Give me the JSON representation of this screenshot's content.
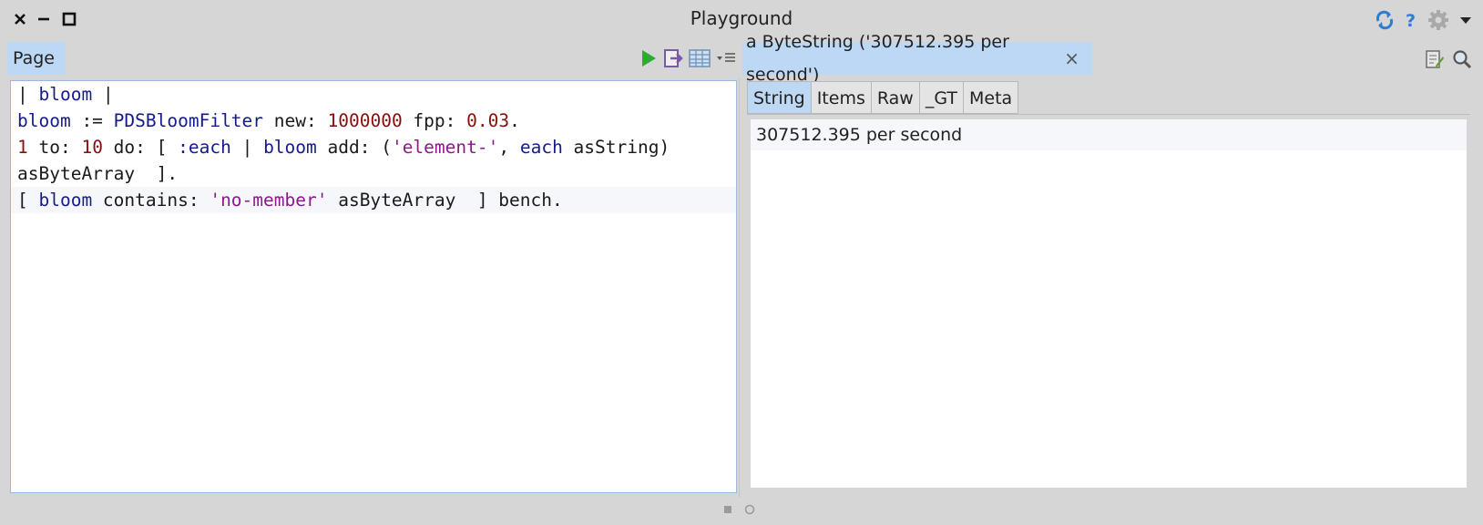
{
  "window": {
    "title": "Playground"
  },
  "left_pane": {
    "tab_label": "Page",
    "code_lines": [
      [
        {
          "t": "| ",
          "c": ""
        },
        {
          "t": "bloom",
          "c": "v"
        },
        {
          "t": " |",
          "c": ""
        }
      ],
      [
        {
          "t": "bloom",
          "c": "v"
        },
        {
          "t": " := ",
          "c": ""
        },
        {
          "t": "PDSBloomFilter",
          "c": "g"
        },
        {
          "t": " new: ",
          "c": ""
        },
        {
          "t": "1000000",
          "c": "n"
        },
        {
          "t": " fpp: ",
          "c": ""
        },
        {
          "t": "0.03",
          "c": "n"
        },
        {
          "t": ".",
          "c": ""
        }
      ],
      [
        {
          "t": "1",
          "c": "n"
        },
        {
          "t": " to: ",
          "c": ""
        },
        {
          "t": "10",
          "c": "n"
        },
        {
          "t": " do: [ ",
          "c": ""
        },
        {
          "t": ":each",
          "c": "v"
        },
        {
          "t": " | ",
          "c": ""
        },
        {
          "t": "bloom",
          "c": "v"
        },
        {
          "t": " add: (",
          "c": ""
        },
        {
          "t": "'element-'",
          "c": "s"
        },
        {
          "t": ", ",
          "c": ""
        },
        {
          "t": "each",
          "c": "v"
        },
        {
          "t": " asString)",
          "c": ""
        }
      ],
      [
        {
          "t": "asByteArray  ].",
          "c": ""
        }
      ],
      [
        {
          "t": "[ ",
          "c": ""
        },
        {
          "t": "bloom",
          "c": "v"
        },
        {
          "t": " contains: ",
          "c": ""
        },
        {
          "t": "'no-member'",
          "c": "s"
        },
        {
          "t": " asByteArray  ] bench.",
          "c": ""
        }
      ]
    ],
    "active_line": 4
  },
  "right_pane": {
    "tab_label": "a ByteString ('307512.395 per second')",
    "close_glyph": "×",
    "subtabs": [
      "String",
      "Items",
      "Raw",
      "_GT",
      "Meta"
    ],
    "active_subtab": 0,
    "result_value": "307512.395 per second"
  },
  "colors": {
    "tab_active": "#bcd8f4",
    "run_green": "#2eaa2e",
    "icon_blue": "#2d7dd2",
    "editor_border": "#9ab9e0"
  },
  "icons": {
    "close": "close-icon",
    "minimize": "minimize-icon",
    "maximize": "maximize-icon",
    "sync": "sync-icon",
    "help": "help-icon",
    "settings": "gear-icon",
    "run": "play-icon",
    "do_it_print": "print-it-icon",
    "bindings": "bindings-icon",
    "menu": "menu-icon",
    "edit": "edit-icon",
    "search": "search-icon"
  }
}
